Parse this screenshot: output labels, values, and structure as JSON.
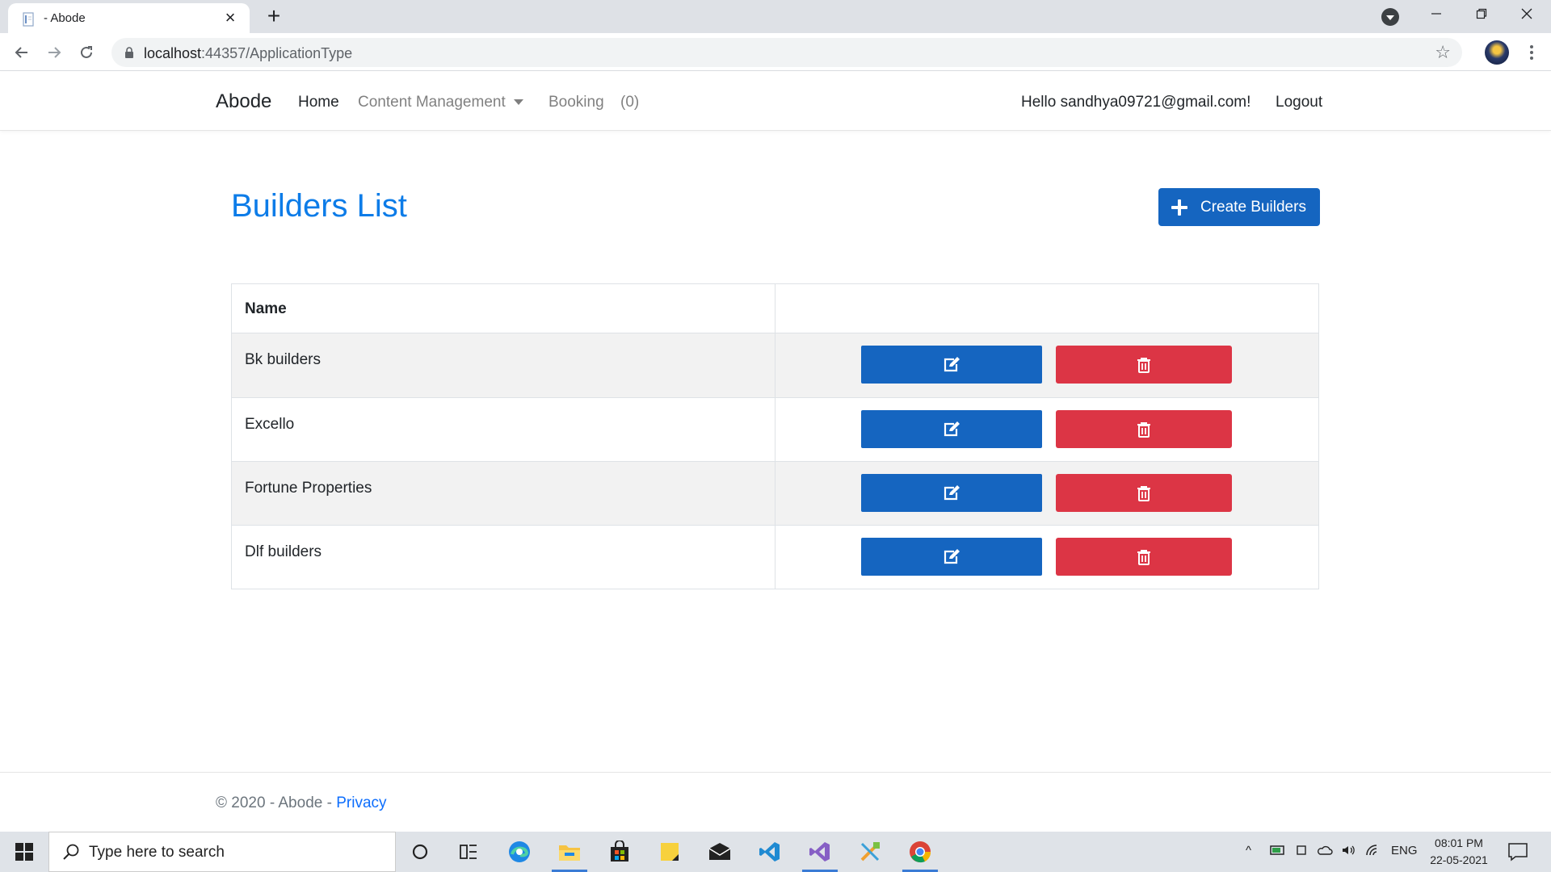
{
  "browser": {
    "tab_title": "- Abode",
    "url_host": "localhost",
    "url_rest": ":44357/ApplicationType"
  },
  "nav": {
    "brand": "Abode",
    "home": "Home",
    "content_management": "Content Management",
    "booking": "Booking",
    "booking_count": "(0)",
    "hello": "Hello sandhya09721@gmail.com!",
    "logout": "Logout"
  },
  "main": {
    "title": "Builders List",
    "create_label": "Create Builders",
    "table": {
      "headers": [
        "Name",
        ""
      ],
      "rows": [
        {
          "name": "Bk builders"
        },
        {
          "name": "Excello"
        },
        {
          "name": "Fortune Properties"
        },
        {
          "name": "Dlf builders"
        }
      ]
    }
  },
  "footer": {
    "copyright": "© 2020 - Abode - ",
    "privacy": "Privacy"
  },
  "taskbar": {
    "search_placeholder": "Type here to search",
    "tray_lang": "ENG",
    "time": "08:01 PM",
    "date": "22-05-2021"
  },
  "colors": {
    "primary": "#1565c0",
    "title_blue": "#0d7ce8",
    "danger": "#dc3545",
    "stripe": "#f2f2f2"
  },
  "icons": {
    "edit": "edit-icon",
    "delete": "trash-icon",
    "create": "plus-icon"
  }
}
